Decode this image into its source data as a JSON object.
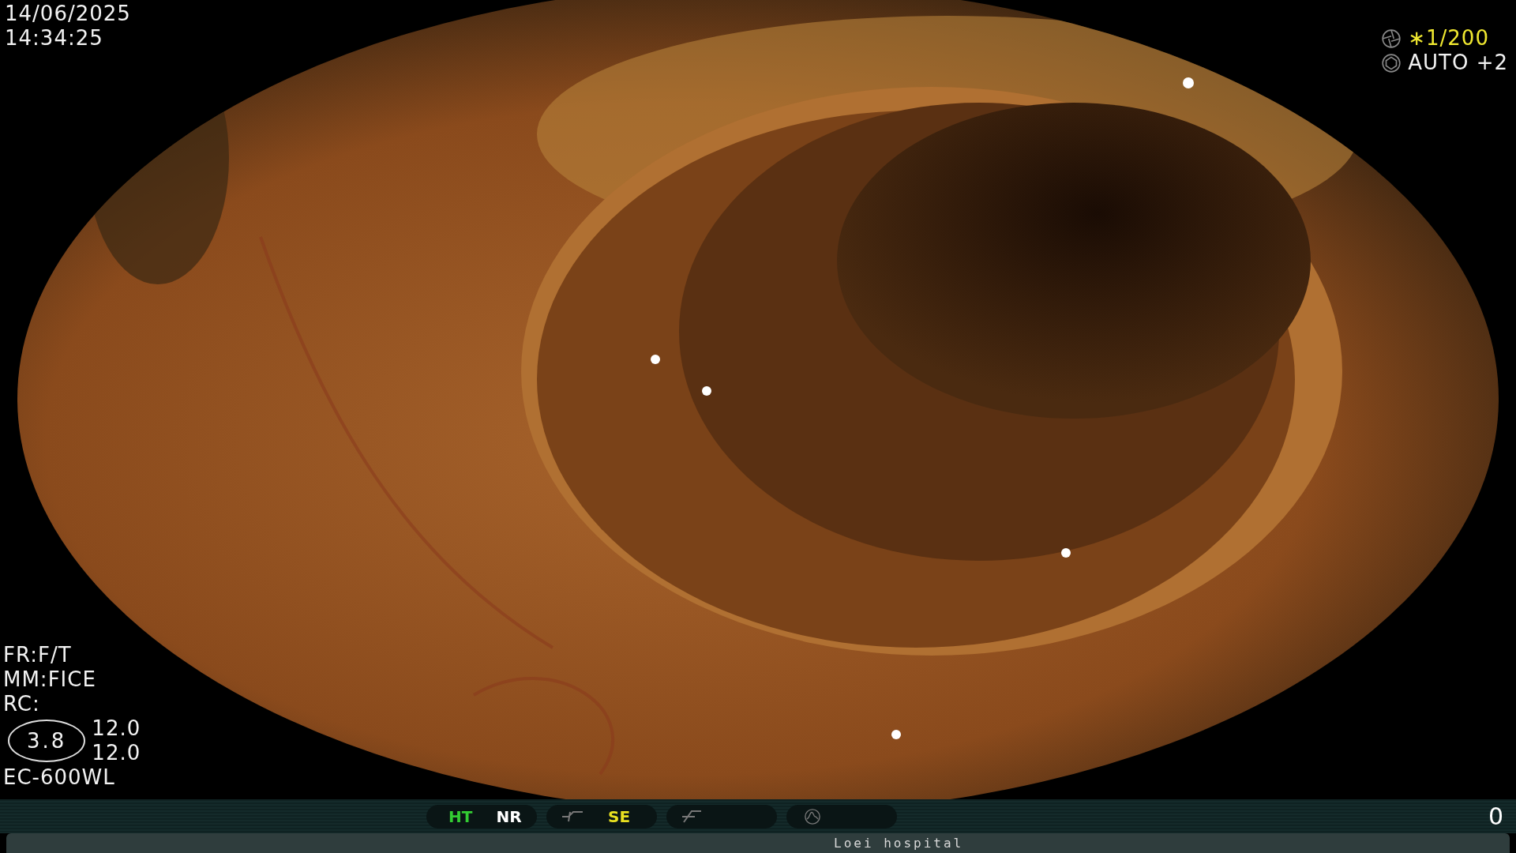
{
  "overlay": {
    "date": "14/06/2025",
    "time": "14:34:25",
    "shutter": "∗1/200",
    "iris": "AUTO +2",
    "settings": [
      "FR:F/T",
      "MM:FICE",
      "RC:"
    ],
    "zoom": "3.8",
    "values": [
      "12.0",
      "12.0"
    ],
    "scope": "EC-600WL"
  },
  "status_bar": {
    "groups": [
      {
        "kind": "labels",
        "items": [
          {
            "label": "HT",
            "color": "#33cc33"
          },
          {
            "label": "NR",
            "color": "#ffffff"
          }
        ]
      },
      {
        "kind": "curve",
        "items": [
          {
            "label": "SE",
            "color": "#e8e020"
          }
        ]
      },
      {
        "kind": "slope"
      },
      {
        "kind": "wave"
      }
    ],
    "counter": "0"
  },
  "footer": {
    "label": "Loei hospital"
  }
}
